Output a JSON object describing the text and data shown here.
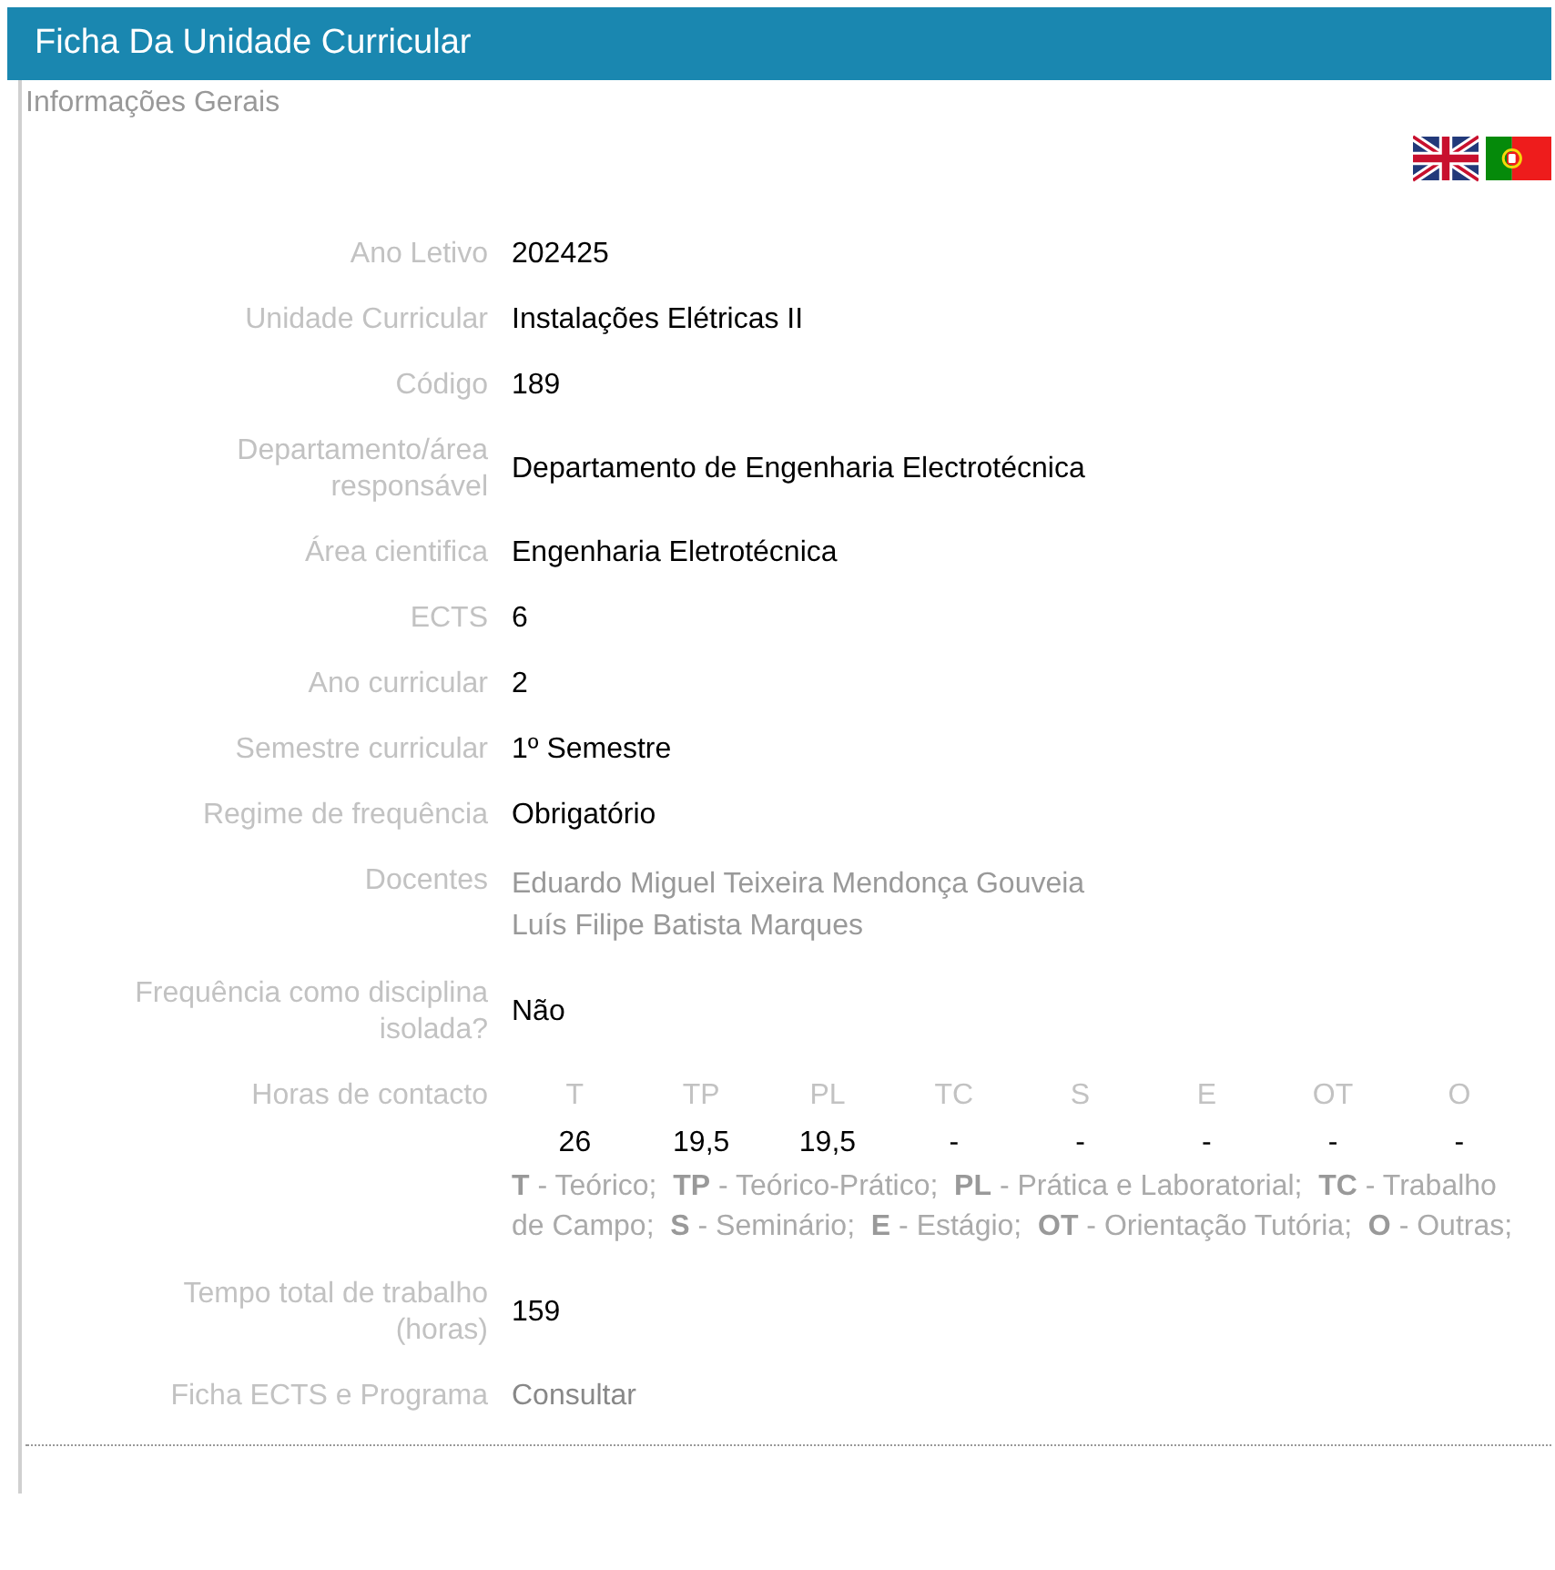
{
  "header": {
    "title": "Ficha Da Unidade Curricular"
  },
  "section": {
    "title": "Informações Gerais"
  },
  "languages": [
    {
      "kind": "uk"
    },
    {
      "kind": "pt"
    }
  ],
  "fields": [
    {
      "kind": "text",
      "label": "Ano Letivo",
      "value": "202425"
    },
    {
      "kind": "text",
      "label": "Unidade Curricular",
      "value": "Instalações Elétricas II"
    },
    {
      "kind": "text",
      "label": "Código",
      "value": "189"
    },
    {
      "kind": "text",
      "label": "Departamento/área\nresponsável",
      "value": "Departamento de Engenharia Electrotécnica"
    },
    {
      "kind": "text",
      "label": "Área cientifica",
      "value": "Engenharia Eletrotécnica"
    },
    {
      "kind": "text",
      "label": "ECTS",
      "value": "6"
    },
    {
      "kind": "text",
      "label": "Ano curricular",
      "value": "2"
    },
    {
      "kind": "text",
      "label": "Semestre curricular",
      "value": "1º Semestre"
    },
    {
      "kind": "text",
      "label": "Regime de frequência",
      "value": "Obrigatório"
    },
    {
      "kind": "people",
      "label": "Docentes",
      "values": [
        "Eduardo Miguel Teixeira Mendonça Gouveia",
        "Luís Filipe Batista Marques"
      ]
    },
    {
      "kind": "text",
      "label": "Frequência como disciplina\nisolada?",
      "value": "Não"
    },
    {
      "kind": "hours",
      "label": "Horas de contacto",
      "columns": [
        "T",
        "TP",
        "PL",
        "TC",
        "S",
        "E",
        "OT",
        "O"
      ],
      "values": [
        "26",
        "19,5",
        "19,5",
        "-",
        "-",
        "-",
        "-",
        "-"
      ],
      "legend": "**T** - Teórico;  **TP** - Teórico-Prático;  **PL** - Prática e Laboratorial;  **TC** - Trabalho de Campo;  **S** - Seminário;  **E** - Estágio;  **OT** - Orientação Tutória;  **O** - Outras;"
    },
    {
      "kind": "text",
      "label": "Tempo total de trabalho\n(horas)",
      "value": "159"
    },
    {
      "kind": "link",
      "label": "Ficha ECTS e Programa",
      "value": "Consultar"
    }
  ]
}
